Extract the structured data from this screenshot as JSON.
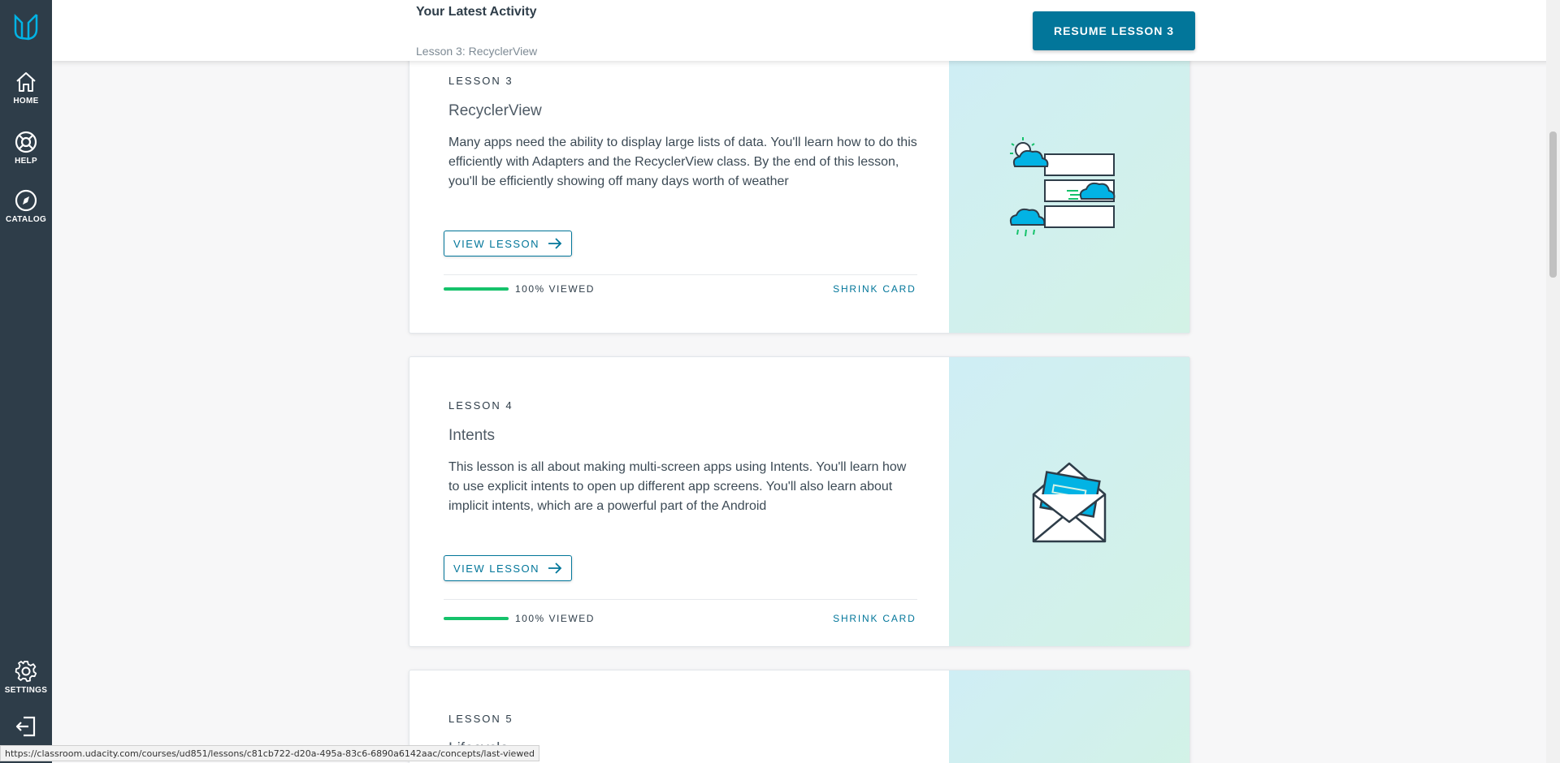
{
  "sidebar": {
    "logo": "udacity-logo-icon",
    "items": [
      {
        "label": "HOME",
        "icon": "home-icon"
      },
      {
        "label": "HELP",
        "icon": "lifebuoy-icon"
      },
      {
        "label": "CATALOG",
        "icon": "compass-icon"
      },
      {
        "label": "SETTINGS",
        "icon": "gear-icon"
      },
      {
        "label": "",
        "icon": "logout-icon"
      }
    ]
  },
  "header": {
    "title": "Your Latest Activity",
    "subtitle": "Lesson 3: RecyclerView",
    "resume_label": "RESUME LESSON 3"
  },
  "lessons": [
    {
      "number_label": "LESSON 3",
      "title": "RecyclerView",
      "description": "Many apps need the ability to display large lists of data. You'll learn how to do this efficiently with Adapters and the RecyclerView class. By the end of this lesson, you'll be efficiently showing off many days worth of weather",
      "view_label": "VIEW LESSON",
      "progress_percent": 100,
      "progress_text": "100% VIEWED",
      "shrink_label": "SHRINK CARD",
      "illustration": "weather-list-icon"
    },
    {
      "number_label": "LESSON 4",
      "title": "Intents",
      "description": "This lesson is all about making multi-screen apps using Intents. You'll learn how to use explicit intents to open up different app screens. You'll also learn about implicit intents, which are a powerful part of the Android",
      "view_label": "VIEW LESSON",
      "progress_percent": 100,
      "progress_text": "100% VIEWED",
      "shrink_label": "SHRINK CARD",
      "illustration": "envelope-icon"
    },
    {
      "number_label": "LESSON 5",
      "title": "Lifecycle",
      "illustration": ""
    }
  ],
  "status_bar": {
    "url": "https://classroom.udacity.com/courses/ud851/lessons/c81cb722-d20a-495a-83c6-6890a6142aac/concepts/last-viewed"
  },
  "colors": {
    "sidebar": "#2e3d49",
    "accent": "#02769a",
    "progress": "#15c26b",
    "logo": "#02b3e4"
  }
}
